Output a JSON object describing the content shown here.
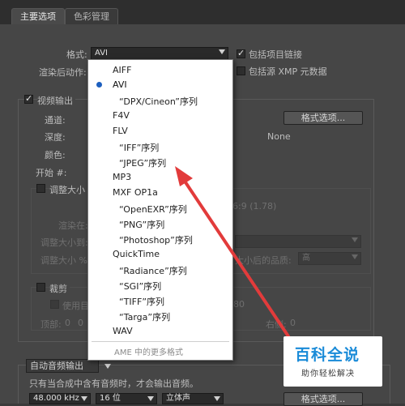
{
  "tabs": [
    {
      "label": "主要选项"
    },
    {
      "label": "色彩管理"
    }
  ],
  "format": {
    "label": "格式:",
    "value": "AVI"
  },
  "render_action": {
    "label": "渲染后动作:"
  },
  "include_project_link": {
    "label": "包括项目链接",
    "checked": true
  },
  "include_xmp": {
    "label": "包括源 XMP 元数据",
    "checked": false
  },
  "video_output": {
    "label": "视频输出",
    "checked": true,
    "channel_label": "通道:",
    "depth_label": "深度:",
    "color_label": "颜色:",
    "start_label": "开始 #:",
    "format_options_button": "格式选项...",
    "codec_value": "None"
  },
  "resize": {
    "label": "调整大小",
    "ratio_text": "6:9 (1.78)",
    "render_at_label": "渲染在:",
    "resize_to_label": "调整大小到:",
    "resize_pct_label": "调整大小 %:",
    "quality_label": "大小后的品质:",
    "quality_value": "高"
  },
  "crop": {
    "label": "裁剪",
    "use_region_label": "使用目",
    "value_80": "80",
    "top_label": "顶部:",
    "top_value": "0",
    "left_value": "0",
    "right_label": "右侧:",
    "right_value": "0"
  },
  "audio": {
    "mode": "自动音频输出",
    "note": "只有当合成中含有音频时，才会输出音频。",
    "sample_rate": "48.000 kHz",
    "bit_depth": "16 位",
    "channels": "立体声",
    "format_options_button": "格式选项..."
  },
  "format_menu": {
    "items": [
      {
        "label": "AIFF",
        "sub": false,
        "selected": false
      },
      {
        "label": "AVI",
        "sub": false,
        "selected": true
      },
      {
        "label": "“DPX/Cineon”序列",
        "sub": true,
        "selected": false
      },
      {
        "label": "F4V",
        "sub": false,
        "selected": false
      },
      {
        "label": "FLV",
        "sub": false,
        "selected": false
      },
      {
        "label": "“IFF”序列",
        "sub": true,
        "selected": false
      },
      {
        "label": "“JPEG”序列",
        "sub": true,
        "selected": false
      },
      {
        "label": "MP3",
        "sub": false,
        "selected": false
      },
      {
        "label": "MXF OP1a",
        "sub": false,
        "selected": false
      },
      {
        "label": "“OpenEXR”序列",
        "sub": true,
        "selected": false
      },
      {
        "label": "“PNG”序列",
        "sub": true,
        "selected": false
      },
      {
        "label": "“Photoshop”序列",
        "sub": true,
        "selected": false
      },
      {
        "label": "QuickTime",
        "sub": false,
        "selected": false
      },
      {
        "label": "“Radiance”序列",
        "sub": true,
        "selected": false
      },
      {
        "label": "“SGI”序列",
        "sub": true,
        "selected": false
      },
      {
        "label": "“TIFF”序列",
        "sub": true,
        "selected": false
      },
      {
        "label": "“Targa”序列",
        "sub": true,
        "selected": false
      },
      {
        "label": "WAV",
        "sub": false,
        "selected": false
      }
    ],
    "more_formats": "AME 中的更多格式"
  },
  "watermark": {
    "title": "百科全说",
    "subtitle": "助你轻松解决"
  },
  "colors": {
    "background": "#464646",
    "menu_background": "#ffffff",
    "selection_bullet": "#1d5fbf",
    "annotation_arrow": "#e23b3b",
    "watermark_blue": "#1a8bd8"
  }
}
